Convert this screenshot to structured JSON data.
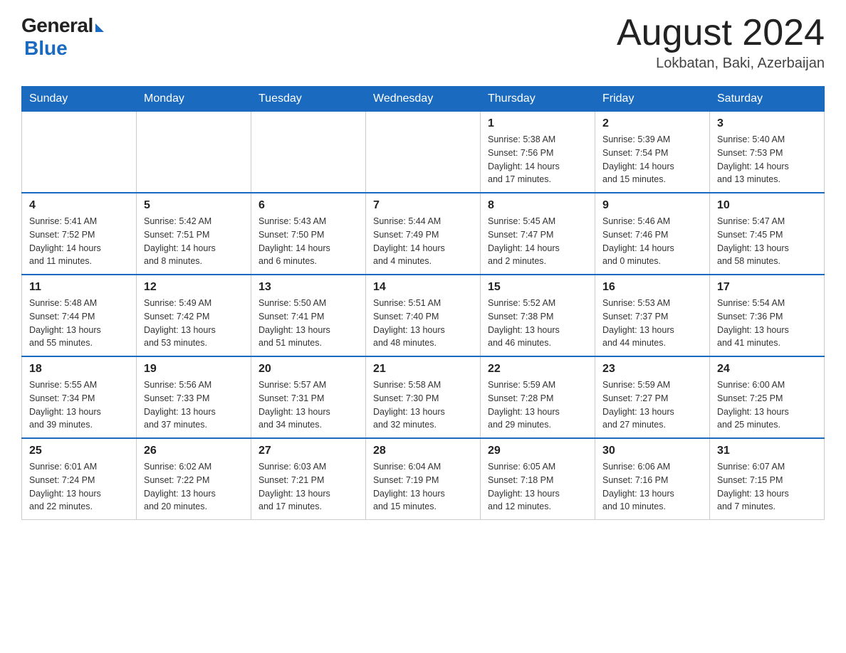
{
  "logo": {
    "general": "General",
    "blue": "Blue"
  },
  "header": {
    "month_year": "August 2024",
    "location": "Lokbatan, Baki, Azerbaijan"
  },
  "weekdays": [
    "Sunday",
    "Monday",
    "Tuesday",
    "Wednesday",
    "Thursday",
    "Friday",
    "Saturday"
  ],
  "weeks": [
    [
      {
        "day": "",
        "info": ""
      },
      {
        "day": "",
        "info": ""
      },
      {
        "day": "",
        "info": ""
      },
      {
        "day": "",
        "info": ""
      },
      {
        "day": "1",
        "info": "Sunrise: 5:38 AM\nSunset: 7:56 PM\nDaylight: 14 hours\nand 17 minutes."
      },
      {
        "day": "2",
        "info": "Sunrise: 5:39 AM\nSunset: 7:54 PM\nDaylight: 14 hours\nand 15 minutes."
      },
      {
        "day": "3",
        "info": "Sunrise: 5:40 AM\nSunset: 7:53 PM\nDaylight: 14 hours\nand 13 minutes."
      }
    ],
    [
      {
        "day": "4",
        "info": "Sunrise: 5:41 AM\nSunset: 7:52 PM\nDaylight: 14 hours\nand 11 minutes."
      },
      {
        "day": "5",
        "info": "Sunrise: 5:42 AM\nSunset: 7:51 PM\nDaylight: 14 hours\nand 8 minutes."
      },
      {
        "day": "6",
        "info": "Sunrise: 5:43 AM\nSunset: 7:50 PM\nDaylight: 14 hours\nand 6 minutes."
      },
      {
        "day": "7",
        "info": "Sunrise: 5:44 AM\nSunset: 7:49 PM\nDaylight: 14 hours\nand 4 minutes."
      },
      {
        "day": "8",
        "info": "Sunrise: 5:45 AM\nSunset: 7:47 PM\nDaylight: 14 hours\nand 2 minutes."
      },
      {
        "day": "9",
        "info": "Sunrise: 5:46 AM\nSunset: 7:46 PM\nDaylight: 14 hours\nand 0 minutes."
      },
      {
        "day": "10",
        "info": "Sunrise: 5:47 AM\nSunset: 7:45 PM\nDaylight: 13 hours\nand 58 minutes."
      }
    ],
    [
      {
        "day": "11",
        "info": "Sunrise: 5:48 AM\nSunset: 7:44 PM\nDaylight: 13 hours\nand 55 minutes."
      },
      {
        "day": "12",
        "info": "Sunrise: 5:49 AM\nSunset: 7:42 PM\nDaylight: 13 hours\nand 53 minutes."
      },
      {
        "day": "13",
        "info": "Sunrise: 5:50 AM\nSunset: 7:41 PM\nDaylight: 13 hours\nand 51 minutes."
      },
      {
        "day": "14",
        "info": "Sunrise: 5:51 AM\nSunset: 7:40 PM\nDaylight: 13 hours\nand 48 minutes."
      },
      {
        "day": "15",
        "info": "Sunrise: 5:52 AM\nSunset: 7:38 PM\nDaylight: 13 hours\nand 46 minutes."
      },
      {
        "day": "16",
        "info": "Sunrise: 5:53 AM\nSunset: 7:37 PM\nDaylight: 13 hours\nand 44 minutes."
      },
      {
        "day": "17",
        "info": "Sunrise: 5:54 AM\nSunset: 7:36 PM\nDaylight: 13 hours\nand 41 minutes."
      }
    ],
    [
      {
        "day": "18",
        "info": "Sunrise: 5:55 AM\nSunset: 7:34 PM\nDaylight: 13 hours\nand 39 minutes."
      },
      {
        "day": "19",
        "info": "Sunrise: 5:56 AM\nSunset: 7:33 PM\nDaylight: 13 hours\nand 37 minutes."
      },
      {
        "day": "20",
        "info": "Sunrise: 5:57 AM\nSunset: 7:31 PM\nDaylight: 13 hours\nand 34 minutes."
      },
      {
        "day": "21",
        "info": "Sunrise: 5:58 AM\nSunset: 7:30 PM\nDaylight: 13 hours\nand 32 minutes."
      },
      {
        "day": "22",
        "info": "Sunrise: 5:59 AM\nSunset: 7:28 PM\nDaylight: 13 hours\nand 29 minutes."
      },
      {
        "day": "23",
        "info": "Sunrise: 5:59 AM\nSunset: 7:27 PM\nDaylight: 13 hours\nand 27 minutes."
      },
      {
        "day": "24",
        "info": "Sunrise: 6:00 AM\nSunset: 7:25 PM\nDaylight: 13 hours\nand 25 minutes."
      }
    ],
    [
      {
        "day": "25",
        "info": "Sunrise: 6:01 AM\nSunset: 7:24 PM\nDaylight: 13 hours\nand 22 minutes."
      },
      {
        "day": "26",
        "info": "Sunrise: 6:02 AM\nSunset: 7:22 PM\nDaylight: 13 hours\nand 20 minutes."
      },
      {
        "day": "27",
        "info": "Sunrise: 6:03 AM\nSunset: 7:21 PM\nDaylight: 13 hours\nand 17 minutes."
      },
      {
        "day": "28",
        "info": "Sunrise: 6:04 AM\nSunset: 7:19 PM\nDaylight: 13 hours\nand 15 minutes."
      },
      {
        "day": "29",
        "info": "Sunrise: 6:05 AM\nSunset: 7:18 PM\nDaylight: 13 hours\nand 12 minutes."
      },
      {
        "day": "30",
        "info": "Sunrise: 6:06 AM\nSunset: 7:16 PM\nDaylight: 13 hours\nand 10 minutes."
      },
      {
        "day": "31",
        "info": "Sunrise: 6:07 AM\nSunset: 7:15 PM\nDaylight: 13 hours\nand 7 minutes."
      }
    ]
  ]
}
